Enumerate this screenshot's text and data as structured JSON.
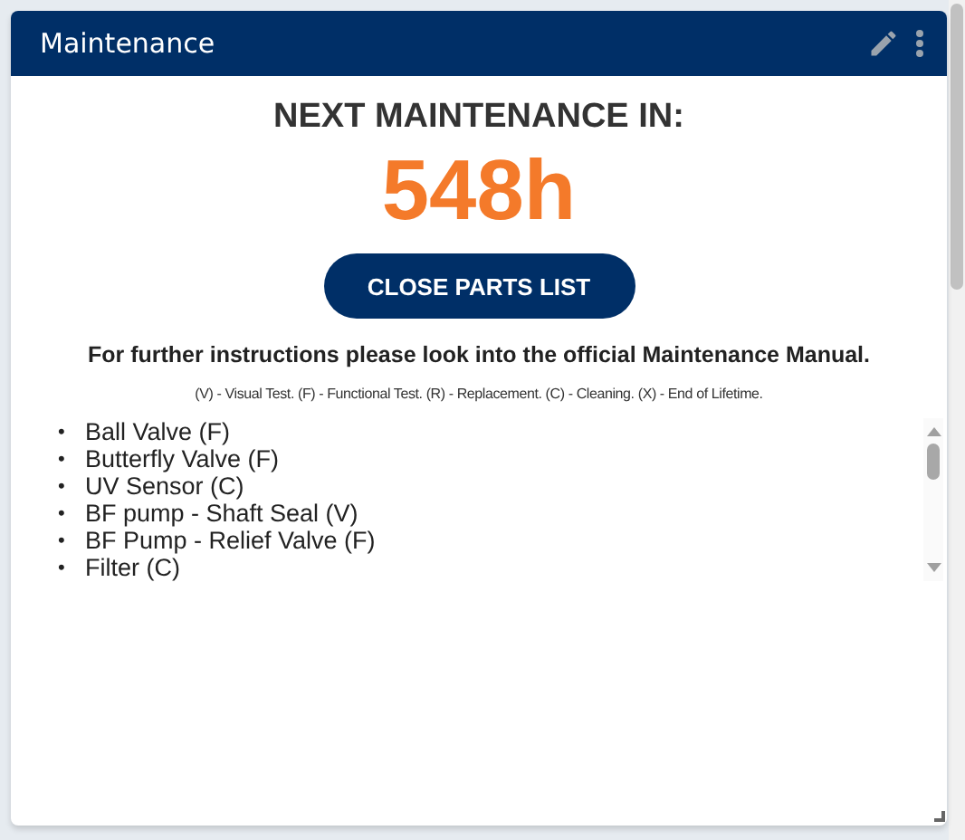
{
  "widget": {
    "title": "Maintenance"
  },
  "heading": "NEXT MAINTENANCE IN:",
  "hours": "548h",
  "button": "CLOSE PARTS LIST",
  "instructions": "For further instructions please look into the official Maintenance Manual.",
  "legend": "(V) - Visual Test. (F) - Functional Test. (R) - Replacement. (C) - Cleaning. (X) - End of Lifetime.",
  "bullet": "•",
  "parts": [
    "Ball Valve (F)",
    "Butterfly Valve (F)",
    "UV Sensor (C)",
    "BF pump - Shaft Seal (V)",
    "BF Pump - Relief Valve (F)",
    "Filter (C)"
  ]
}
